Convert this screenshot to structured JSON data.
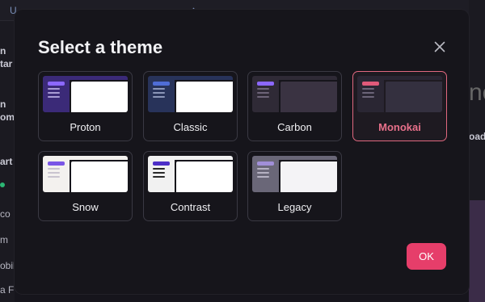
{
  "background": {
    "topbar_left": "U",
    "topbar_right": "˄",
    "fragments": [
      "n",
      "tar",
      "n",
      "om",
      "art",
      "co",
      "m",
      "obil",
      "a F"
    ],
    "right_big": "ne",
    "right_small": "oad"
  },
  "modal": {
    "title": "Select a theme",
    "close_icon": "close-icon",
    "ok_label": "OK",
    "themes": [
      {
        "label": "Proton",
        "selected": false
      },
      {
        "label": "Classic",
        "selected": false
      },
      {
        "label": "Carbon",
        "selected": false
      },
      {
        "label": "Monokai",
        "selected": true
      },
      {
        "label": "Snow",
        "selected": false
      },
      {
        "label": "Contrast",
        "selected": false
      },
      {
        "label": "Legacy",
        "selected": false
      }
    ]
  },
  "colors": {
    "accent": "#e63e6a",
    "selected_border": "#e0687f",
    "selected_label": "#e8708a"
  }
}
